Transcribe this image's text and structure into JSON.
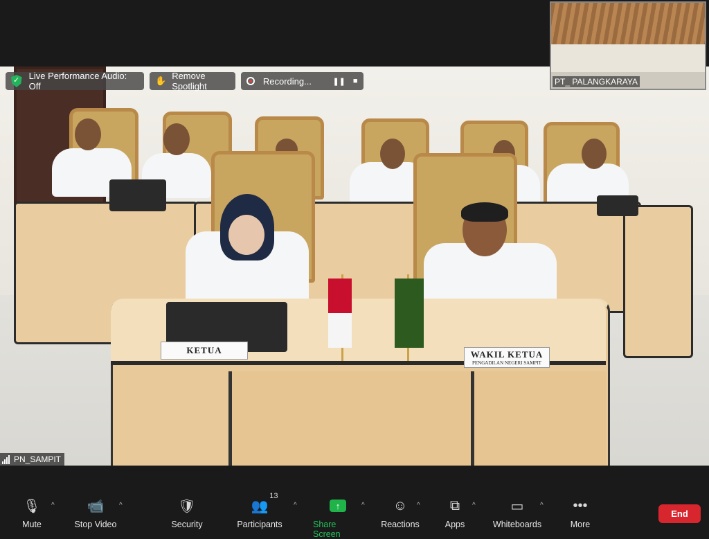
{
  "overlay": {
    "audio_label": "Live Performance Audio: Off",
    "spotlight_label": "Remove Spotlight",
    "recording_label": "Recording...",
    "pause_symbol": "❚❚",
    "stop_symbol": "■"
  },
  "thumbnail": {
    "name": "PT_ PALANGKARAYA"
  },
  "main_video": {
    "participant_name": "PN_SAMPIT",
    "nameplates": {
      "ketua": "KETUA",
      "wakil_ketua": "WAKIL KETUA",
      "wakil_sub": "PENGADILAN NEGERI SAMPIT"
    }
  },
  "toolbar": {
    "mute": {
      "label": "Mute",
      "icon": "microphone-icon"
    },
    "stop_video": {
      "label": "Stop Video",
      "icon": "video-camera-icon"
    },
    "security": {
      "label": "Security",
      "icon": "shield-icon"
    },
    "participants": {
      "label": "Participants",
      "count": "13",
      "icon": "people-icon"
    },
    "share_screen": {
      "label": "Share Screen",
      "icon": "share-arrow-icon"
    },
    "reactions": {
      "label": "Reactions",
      "icon": "smiley-icon"
    },
    "apps": {
      "label": "Apps",
      "icon": "apps-icon"
    },
    "whiteboards": {
      "label": "Whiteboards",
      "icon": "whiteboard-icon"
    },
    "more": {
      "label": "More",
      "icon": "more-dots-icon"
    },
    "end": {
      "label": "End"
    }
  },
  "colors": {
    "share_green": "#23c45a",
    "end_red": "#d8262f",
    "toolbar_bg": "#1a1a1a"
  }
}
